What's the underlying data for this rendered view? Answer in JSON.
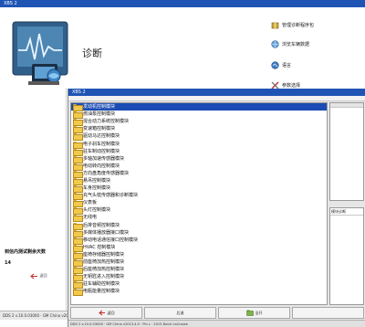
{
  "back_window": {
    "title": "XBS 2",
    "section_title": "诊断",
    "menu": [
      {
        "label": "管理诊断程序包",
        "icon": "package-icon"
      },
      {
        "label": "浏览车辆数据",
        "icon": "globe-icon"
      },
      {
        "label": "语言",
        "icon": "language-icon"
      },
      {
        "label": "参数选择",
        "icon": "tools-icon"
      }
    ],
    "remaining_days_label": "到信内测试剩余天数",
    "remaining_days_value": "14",
    "back_button": "返回",
    "status": "DDS 2 v.10.0.03000 · GM China v2013.4 · Pin L"
  },
  "front_window": {
    "title": "XBS 2",
    "modules": [
      "发动机控制模块",
      "燃油泵控制模块",
      "混合动力系统控制模块",
      "变速箱控制模块",
      "驱动马达控制模块",
      "电子刹车控制模块",
      "驻车制动控制模块",
      "多轴加速传感器模块",
      "电动转向控制模块",
      "方向盘角度传感器模块",
      "悬吊控制模块",
      "车身控制模块",
      "充气头枕传感器和诊断模块",
      "仪表板",
      "头灯控制模块",
      "无线电",
      "后排音频控制模块",
      "多媒体播放器接口模块",
      "移动电话通信接口控制模块",
      "HVAC 控制模块",
      "座椅存储器控制模块",
      "前座椅加热控制模块",
      "后座椅加热控制模块",
      "无钥匙进入控制模块",
      "驻车辅助控制模块",
      "电瓶能量控制模块"
    ],
    "right_label": "模块诊断",
    "buttons": [
      {
        "label": "返回",
        "icon": "back-arrow-icon"
      },
      {
        "label": "后退",
        "icon": "blank-icon"
      },
      {
        "label": "全开",
        "icon": "folder-open-icon"
      },
      {
        "label": "",
        "icon": "blank-icon"
      }
    ],
    "status": "DDS 2 v.10.0.03000 · GM China v2013.4.0 · Pin L · 2013 Buick LaCrosse"
  },
  "colors": {
    "titlebar": "#1f54b5",
    "selection": "#1c4db4",
    "folder": "#f2c94c"
  }
}
